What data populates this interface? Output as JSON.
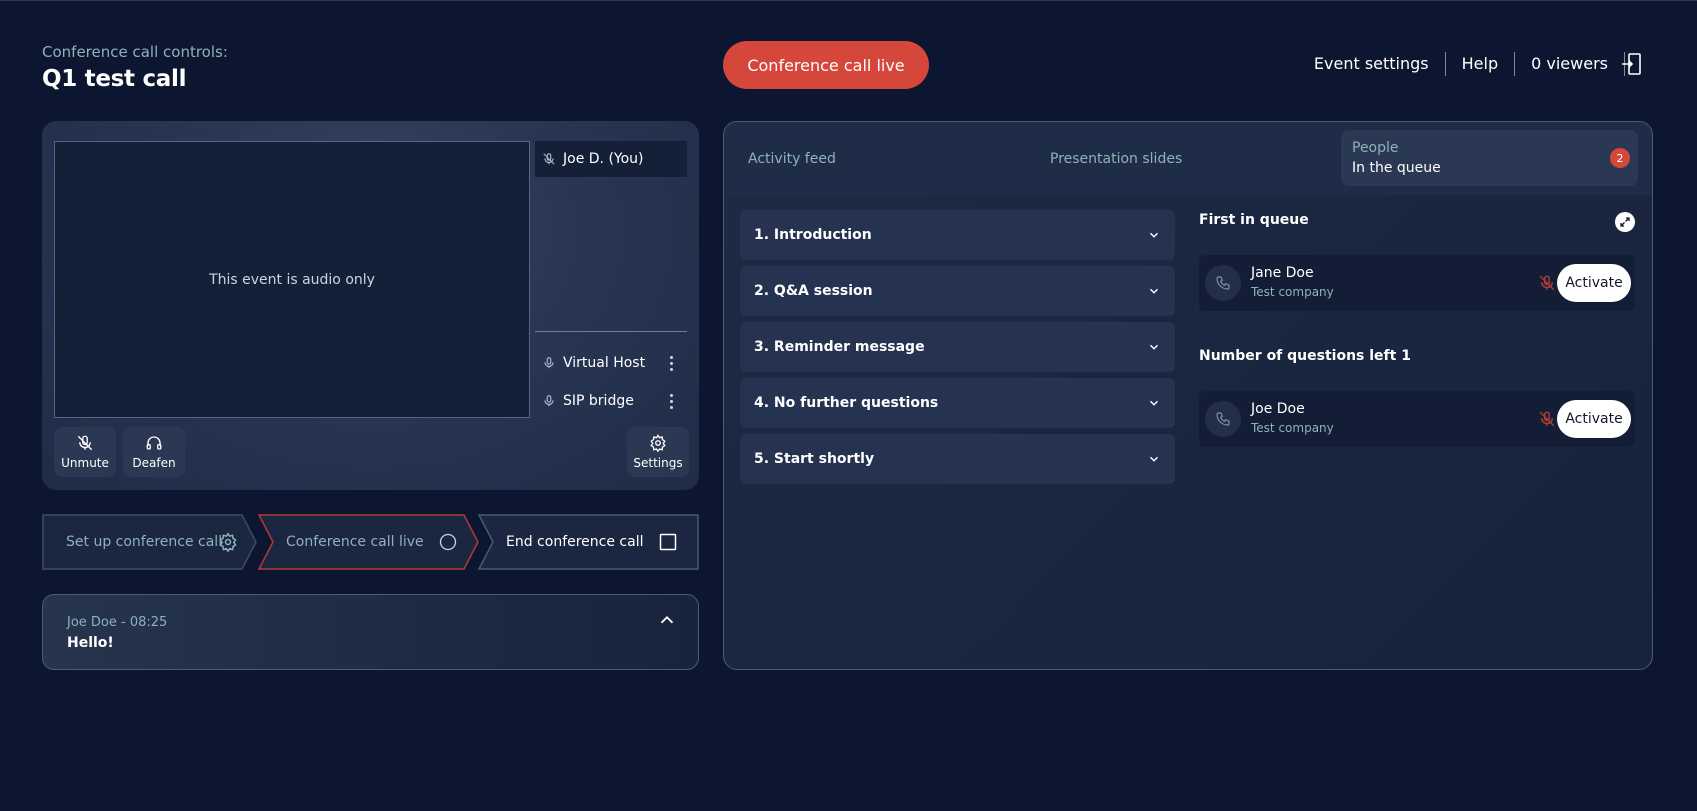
{
  "header": {
    "subtitle": "Conference call controls:",
    "title": "Q1 test call",
    "live_button": "Conference call live",
    "nav": [
      "Event settings",
      "Help",
      "0 viewers"
    ]
  },
  "stage": {
    "video_message": "This event is audio only",
    "participants": [
      {
        "name": "Joe D. (You)",
        "icon": "mic-off-icon"
      },
      {
        "name": "Virtual Host",
        "icon": "mic-icon"
      },
      {
        "name": "SIP bridge",
        "icon": "mic-icon"
      }
    ],
    "controls": {
      "unmute": "Unmute",
      "deafen": "Deafen",
      "settings": "Settings"
    }
  },
  "stepper": [
    {
      "label": "Set up conference call",
      "icon": "gear-icon",
      "state": "done"
    },
    {
      "label": "Conference call live",
      "icon": "circle-icon",
      "state": "active"
    },
    {
      "label": "End conference call",
      "icon": "square-icon",
      "state": "next"
    }
  ],
  "chat": {
    "meta": "Joe Doe - 08:25",
    "message": "Hello!"
  },
  "tabs": {
    "activity": "Activity feed",
    "slides": "Presentation slides",
    "people_title": "People",
    "people_sub": "In the queue",
    "people_badge": "2"
  },
  "accordion": [
    "1. Introduction",
    "2. Q&A session",
    "3. Reminder message",
    "4. No further questions",
    "5. Start shortly"
  ],
  "queue": {
    "first_title": "First in queue",
    "first": {
      "name": "Jane Doe",
      "company": "Test company",
      "action": "Activate"
    },
    "remaining_title": "Number of questions left 1",
    "remaining": [
      {
        "name": "Joe Doe",
        "company": "Test company",
        "action": "Activate"
      }
    ]
  },
  "colors": {
    "background": "#0d1630",
    "accent_red": "#d5473a",
    "muted_teal": "#8fb2b8"
  }
}
